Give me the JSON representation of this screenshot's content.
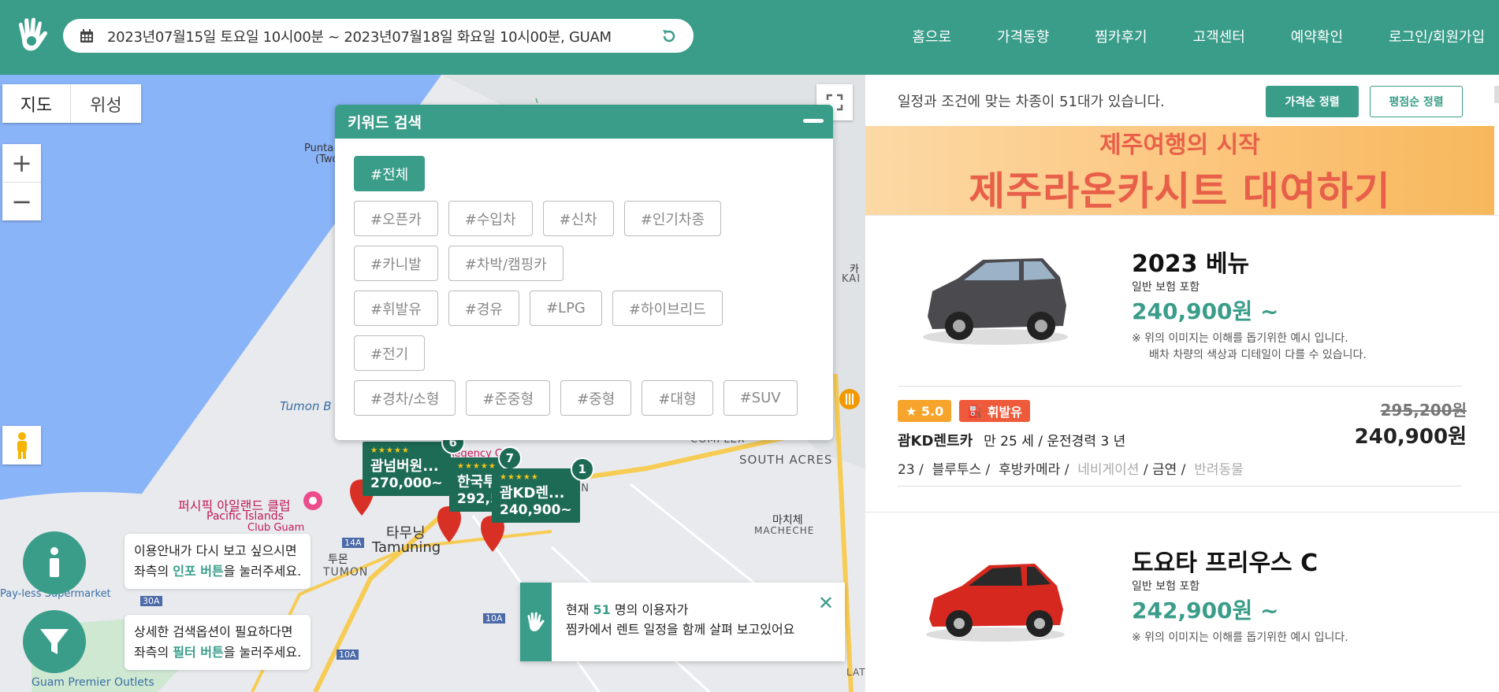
{
  "header": {
    "date_range": "2023년07월15일 토요일 10시00분 ~ 2023년07월18일 화요일 10시00분, GUAM",
    "nav": [
      "홈으로",
      "가격동향",
      "찜카후기",
      "고객센터",
      "예약확인",
      "로그인/회원가입"
    ]
  },
  "map": {
    "toggle": [
      "지도",
      "위성"
    ],
    "zoom_in": "+",
    "zoom_out": "−",
    "labels": {
      "punta": "Punta",
      "punta2": "(Two",
      "tumon_bay": "Tumon B",
      "complex": "COMPLEX",
      "south_acres": "SOUTH ACRES",
      "machache_kr": "마치체",
      "machache_en": "MACHECHE",
      "tamuning_kr": "타무닝",
      "tamuning_en": "Tamuning",
      "tumon_kr": "투몬",
      "tumon_en": "TUMON",
      "pacific_kr": "퍼시픽 아일랜드 클럽",
      "pacific_en1": "Pacific Islands",
      "pacific_en2": "Club Guam",
      "kai": "KAI",
      "ka": "카",
      "route_14a": "14A",
      "route_30a": "30A",
      "route_10a": "10A",
      "route_10a_2": "10A",
      "pay_less": "Pay-less Supermarket",
      "premier": "Guam Premier Outlets",
      "regency": "Regency G",
      "on": "ON",
      "lat": "LAT"
    }
  },
  "keyword": {
    "title": "키워드 검색",
    "rows": [
      [
        "#전체"
      ],
      [
        "#오픈카",
        "#수입차",
        "#신차",
        "#인기차종"
      ],
      [
        "#카니발",
        "#차박/캠핑카"
      ],
      [
        "#휘발유",
        "#경유",
        "#LPG",
        "#하이브리드"
      ],
      [
        "#전기"
      ],
      [
        "#경차/소형",
        "#준중형",
        "#중형",
        "#대형",
        "#SUV"
      ]
    ]
  },
  "markers": [
    {
      "stars": "★★★★★",
      "name": "괌넘버원...",
      "price": "270,000~",
      "count": "6"
    },
    {
      "stars": "★★★★★",
      "name": "한국투",
      "price": "292,5",
      "count": "7"
    },
    {
      "stars": "★★★★★",
      "name": "괌KD렌...",
      "price": "240,900~",
      "count": "1"
    }
  ],
  "help": {
    "info_line1": "이용안내가 다시 보고 싶으시면",
    "info_line2_pre": "좌측의 ",
    "info_line2_b": "인포 버튼",
    "info_line2_post": "을 눌러주세요.",
    "filter_line1": "상세한 검색옵션이 필요하다면",
    "filter_line2_pre": "좌측의 ",
    "filter_line2_b": "필터 버튼",
    "filter_line2_post": "을 눌러주세요."
  },
  "toast": {
    "pre": "현재 ",
    "count": "51",
    "post": " 명의 이용자가",
    "line2": "찜카에서 렌트 일정을 함께 살펴 보고있어요"
  },
  "results": {
    "count_text": "일정과 조건에 맞는 차종이 51대가 있습니다.",
    "sort_price": "가격순 정렬",
    "sort_rating": "평점순 정렬",
    "banner_line1": "제주여행의 시작",
    "banner_line2": "제주라온카시트 대여하기"
  },
  "cars": [
    {
      "name": "2023 베뉴",
      "insurance": "일반 보험 포함",
      "price": "240,900원 ~",
      "note1": "※ 위의 이미지는 이해를 돕기위한 예시 입니다.",
      "note2": "배차 차량의 색상과 디테일이 다를 수 있습니다.",
      "rating": "5.0",
      "fuel": "휘발유",
      "company": "괌KD렌트카",
      "conditions": "만 25 세 / 운전경력 3 년",
      "opt_year": "23 /",
      "opt_bt": "블루투스 /",
      "opt_cam": "후방카메라 /",
      "opt_nav": "네비게이션",
      "opt_smoke": "/ 금연 /",
      "opt_pet": "반려동물",
      "old_price": "295,200원",
      "final_price": "240,900원",
      "color": "#4a4a4f"
    },
    {
      "name": "도요타 프리우스 C",
      "insurance": "일반 보험 포함",
      "price": "242,900원 ~",
      "note1": "※ 위의 이미지는 이해를 돕기위한 예시 입니다.",
      "color": "#d6281e"
    }
  ],
  "colors": {
    "brand": "#3a9d8a",
    "marker": "#1e6b55",
    "accent": "#e8604a"
  }
}
